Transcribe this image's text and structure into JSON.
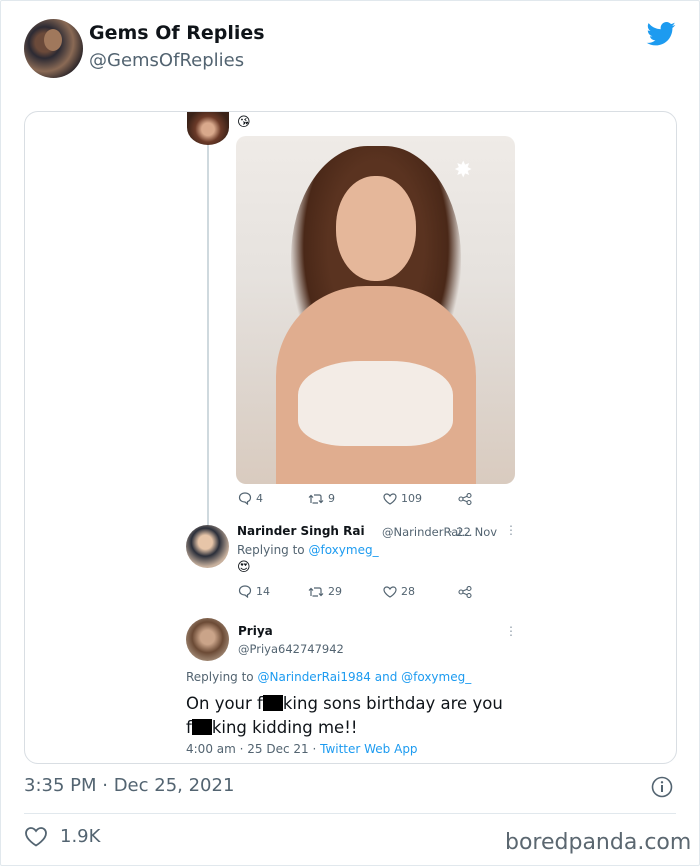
{
  "author": {
    "name": "Gems Of Replies",
    "handle": "@GemsOfReplies"
  },
  "quoted": {
    "first_emoji": "😘",
    "first_tweet_actions": {
      "replies": "4",
      "retweets": "9",
      "likes": "109"
    },
    "reply1": {
      "name": "Narinder Singh Rai",
      "handle": "@NarinderRai...",
      "date": "· 22 Nov",
      "replying_prefix": "Replying to",
      "replying_to": "@foxymeg_",
      "emoji": "😍",
      "actions": {
        "replies": "14",
        "retweets": "29",
        "likes": "28"
      }
    },
    "reply2": {
      "name": "Priya",
      "handle": "@Priya642747942",
      "replying_prefix": "Replying to",
      "replying_to": "@NarinderRai1984 and @foxymeg_",
      "line1_a": "On your f",
      "line1_b": "king sons birthday are you",
      "line2_a": "f",
      "line2_b": "king kidding me!!",
      "timestamp": "4:00 am · 25 Dec 21 · ",
      "source": "Twitter Web App"
    }
  },
  "timestamp": "3:35 PM · Dec 25, 2021",
  "likes": "1.9K",
  "watermark": "boredpanda.com",
  "colors": {
    "twitter_blue": "#1d9bf0",
    "muted": "#536471"
  }
}
